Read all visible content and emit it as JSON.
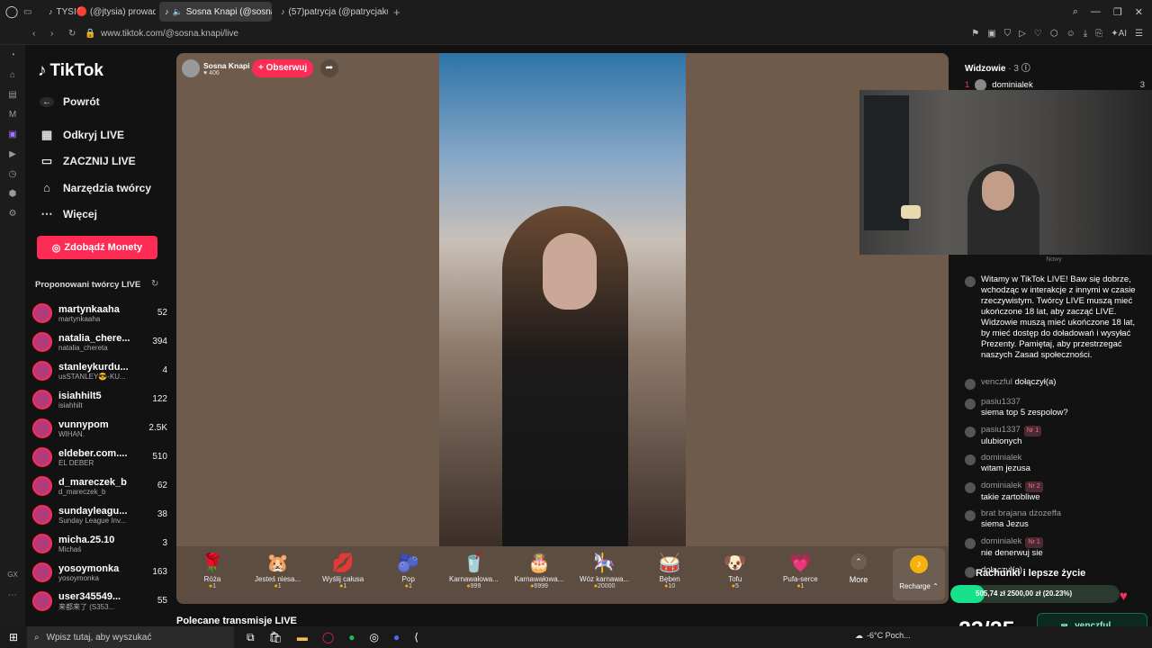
{
  "tabs": [
    {
      "label": "TYSI🔴 (@jtysia) prowadz",
      "icon": "tiktok-icon"
    },
    {
      "label": "Sosna Knapi (@sosna",
      "icon": "tiktok-icon"
    },
    {
      "label": "(57)patrycja (@patrycjaku",
      "icon": "tiktok-icon"
    }
  ],
  "address": {
    "url": "www.tiktok.com/@sosna.knapi/live"
  },
  "sidebar": {
    "brand": "TikTok",
    "back": "Powrót",
    "nav": [
      "Odkryj LIVE",
      "ZACZNIJ LIVE",
      "Narzędzia twórcy",
      "Więcej"
    ],
    "coins_button": "Zdobądź Monety",
    "suggested_title": "Proponowani twórcy LIVE",
    "creators": [
      {
        "name": "martynkaaha",
        "sub": "martynkaaha",
        "viewers": "52"
      },
      {
        "name": "natalia_chere...",
        "sub": "natalia_chereta",
        "viewers": "394"
      },
      {
        "name": "stanleykurdu...",
        "sub": "usSTANLEY😎-KU...",
        "viewers": "4"
      },
      {
        "name": "isiahhilt5",
        "sub": "isiahhilt",
        "viewers": "122"
      },
      {
        "name": "vunnypom",
        "sub": "WIHAN.",
        "viewers": "2.5K"
      },
      {
        "name": "eldeber.com....",
        "sub": "EL DEBER",
        "viewers": "510"
      },
      {
        "name": "d_mareczek_b",
        "sub": "d_mareczek_b",
        "viewers": "62"
      },
      {
        "name": "sundayleagu...",
        "sub": "Sunday League Inv...",
        "viewers": "38"
      },
      {
        "name": "micha.25.10",
        "sub": "Michaś",
        "viewers": "3"
      },
      {
        "name": "yosoymonka",
        "sub": "yosoymonka",
        "viewers": "163"
      },
      {
        "name": "user345549...",
        "sub": "来都来了 (S353...",
        "viewers": "55"
      }
    ]
  },
  "stream": {
    "host": "Sosna Knapi",
    "likes": "406",
    "follow": "+ Obserwuj",
    "gifts": [
      {
        "name": "Róża",
        "price": "1",
        "icon": "🌹"
      },
      {
        "name": "Jesteś niesa...",
        "price": "1",
        "icon": "🐹"
      },
      {
        "name": "Wyślij całusa",
        "price": "1",
        "icon": "💋"
      },
      {
        "name": "Pop",
        "price": "1",
        "icon": "🫐"
      },
      {
        "name": "Karnawałowa...",
        "price": "999",
        "icon": "🥤"
      },
      {
        "name": "Karnawałowa...",
        "price": "6999",
        "icon": "🎂"
      },
      {
        "name": "Wóz karnawa...",
        "price": "20000",
        "icon": "🎠"
      },
      {
        "name": "Bęben",
        "price": "10",
        "icon": "🥁"
      },
      {
        "name": "Tofu",
        "price": "5",
        "icon": "🐶"
      },
      {
        "name": "Pufa-serce",
        "price": "1",
        "icon": "💗"
      }
    ],
    "more": "More",
    "recharge": "Recharge"
  },
  "recommended": "Polecane transmisje LIVE",
  "viewers_panel": {
    "title": "Widzowie",
    "count": "· 3",
    "top_user": "dominialek",
    "top_rank": "1",
    "top_score": "3",
    "new_label": "Nowy"
  },
  "chat": [
    {
      "user": "",
      "text": "Witamy w TikTok LIVE! Baw się dobrze, wchodząc w interakcje z innymi w czasie rzeczywistym. Twórcy LIVE muszą mieć ukończone 18 lat, aby zacząć LIVE. Widzowie muszą mieć ukończone 18 lat, by mieć dostęp do doładowań i wysyłać Prezenty. Pamiętaj, aby przestrzegać naszych Zasad społeczności."
    },
    {
      "user": "venczful",
      "text": "dołączył(a)"
    },
    {
      "user": "pasiu1337",
      "text": "siema top 5 zespolow?"
    },
    {
      "user": "pasiu1337",
      "badge": "Nr 1",
      "text": "ulubionych"
    },
    {
      "user": "dominialek",
      "text": "witam jezusa"
    },
    {
      "user": "dominialek",
      "badge": "Nr 2",
      "text": "takie zartobliwe"
    },
    {
      "user": "brat brajana dżozeffa",
      "text": "siema Jezus"
    },
    {
      "user": "dominialek",
      "badge": "Nr 1",
      "text": "nie denerwuj sie"
    },
    {
      "user": "",
      "text": "dołączył(a)"
    }
  ],
  "overlay": {
    "title": "Rachunki i lepsze życie",
    "progress_text": "505,74 zł 2500,00 zł (20.23%)",
    "progress": 0.2023,
    "counter": "23/25",
    "insta": "venczful"
  },
  "taskbar": {
    "search": "Wpisz tutaj, aby wyszukać",
    "weather": "-6°C Poch...",
    "colors": {
      "accent": "#fe2c55",
      "progress": "#19e08a"
    }
  }
}
